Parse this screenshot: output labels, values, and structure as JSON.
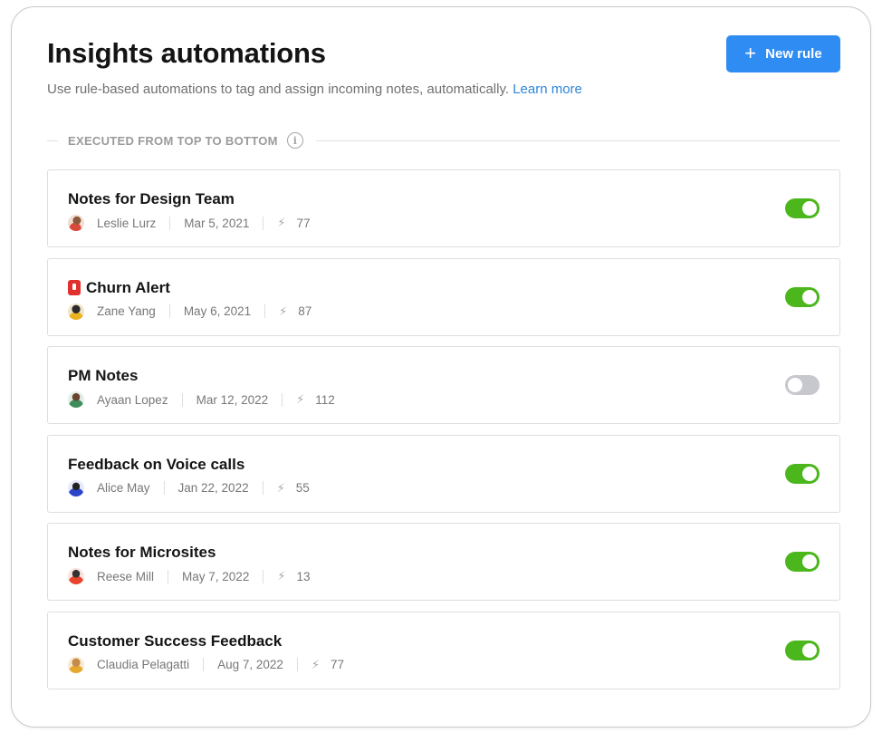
{
  "header": {
    "title": "Insights automations",
    "subtitle": "Use rule-based automations to tag and assign incoming notes, automatically.",
    "learn_more": "Learn more",
    "new_rule_label": "New rule",
    "new_rule_icon": "plus-icon"
  },
  "section": {
    "label": "EXECUTED FROM TOP TO BOTTOM",
    "info_icon": "info-icon"
  },
  "colors": {
    "accent": "#2f8cf2",
    "link": "#2f86d8",
    "toggle_on": "#4cb71c",
    "toggle_off": "#c6c8cd"
  },
  "rules": [
    {
      "name": "Notes for Design Team",
      "author": "Leslie Lurz",
      "date": "Mar 5, 2021",
      "count": "77",
      "enabled": true,
      "icon": ""
    },
    {
      "name": "Churn Alert",
      "author": "Zane Yang",
      "date": "May 6, 2021",
      "count": "87",
      "enabled": true,
      "icon": "alert-icon"
    },
    {
      "name": "PM Notes",
      "author": "Ayaan Lopez",
      "date": "Mar 12, 2022",
      "count": "112",
      "enabled": false,
      "icon": ""
    },
    {
      "name": "Feedback on Voice calls",
      "author": "Alice May",
      "date": "Jan 22, 2022",
      "count": "55",
      "enabled": true,
      "icon": ""
    },
    {
      "name": "Notes for Microsites",
      "author": "Reese Mill",
      "date": "May 7, 2022",
      "count": "13",
      "enabled": true,
      "icon": ""
    },
    {
      "name": "Customer Success Feedback",
      "author": "Claudia Pelagatti",
      "date": "Aug 7, 2022",
      "count": "77",
      "enabled": true,
      "icon": ""
    }
  ]
}
